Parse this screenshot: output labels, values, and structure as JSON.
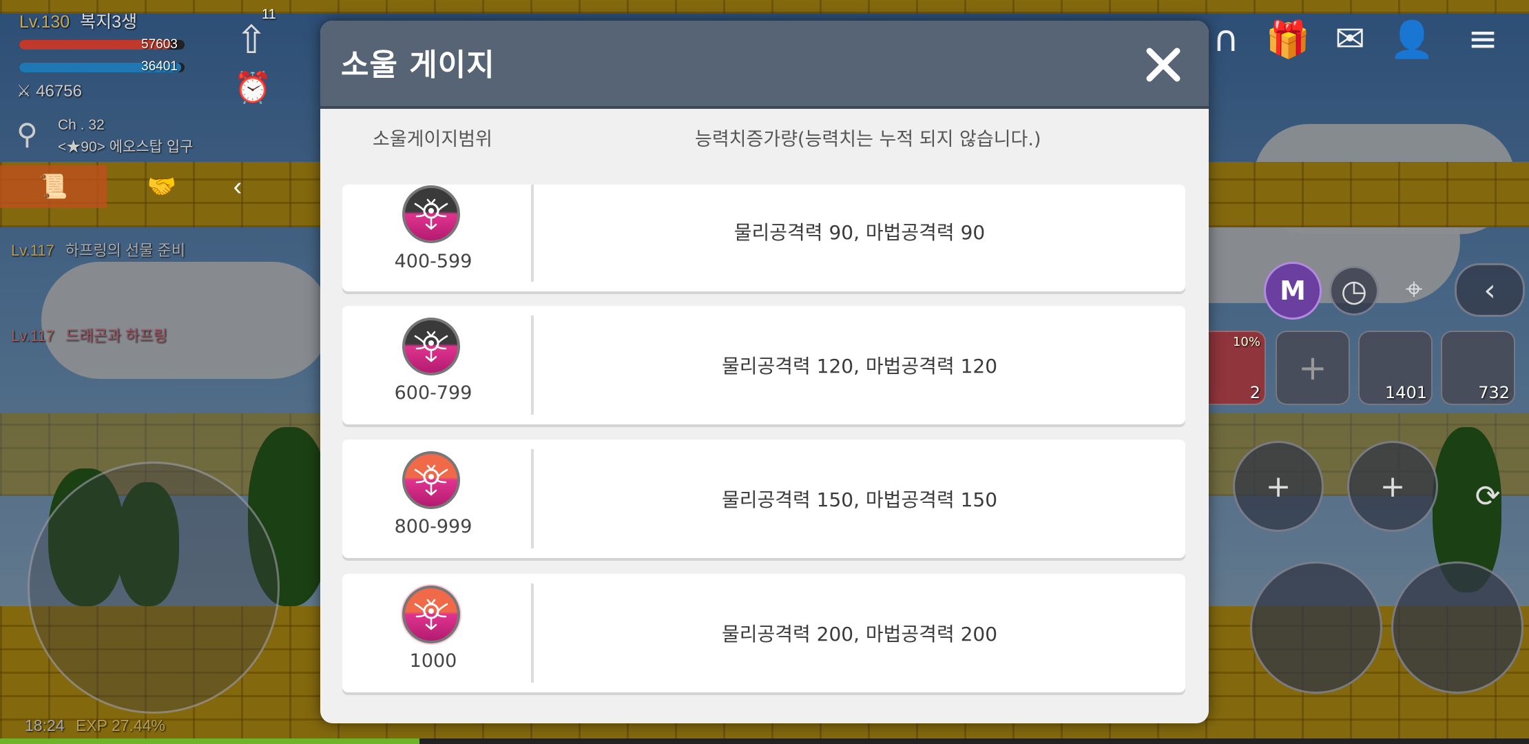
{
  "player": {
    "level": "Lv.130",
    "name": "복지3생",
    "hp": "57603",
    "mp": "36401",
    "combat_power": "46756",
    "channel": "Ch . 32",
    "location": "<★90> 에오스탑 입구",
    "hp_fill": 0.92,
    "mp_fill": 0.98
  },
  "hud": {
    "level_badge_count": "11",
    "time": "18:24",
    "exp": "EXP 27.44%",
    "exp_fill": 0.2744
  },
  "quests": [
    {
      "level": "Lv.117",
      "title": "하프링의 선물 준비"
    },
    {
      "level": "Lv.117",
      "title": "드래곤과 하프링"
    }
  ],
  "quickslots": [
    {
      "count": "2",
      "badge": "10%"
    },
    {
      "count": ""
    },
    {
      "count": "1401"
    },
    {
      "count": "732"
    }
  ],
  "modal": {
    "title": "소울 게이지",
    "col_range": "소울게이지범위",
    "col_stat": "능력치증가량(능력치는 누적 되지 않습니다.)",
    "rows": [
      {
        "range": "400-599",
        "stat": "물리공격력 90, 마법공격력 90"
      },
      {
        "range": "600-799",
        "stat": "물리공격력 120, 마법공격력 120"
      },
      {
        "range": "800-999",
        "stat": "물리공격력 150, 마법공격력 150"
      },
      {
        "range": "1000",
        "stat": "물리공격력 200, 마법공격력 200"
      }
    ]
  },
  "colors": {
    "header": "#566476",
    "badge_dark": "#3a3a3a",
    "badge_pink": "#e0338f",
    "badge_orange": "#f06a4a"
  },
  "icons": [
    "sword-icon",
    "location-pin-icon",
    "scroll-icon",
    "handshake-icon",
    "chevron-left-icon",
    "arrow-up-icon",
    "alarm-icon",
    "ring-icon",
    "gift-icon",
    "mail-icon",
    "character-icon",
    "menu-icon",
    "maple-m-icon",
    "clock-icon",
    "map-pin-icon",
    "plus-icon",
    "refresh-icon",
    "close-icon",
    "soul-emblem-icon"
  ]
}
